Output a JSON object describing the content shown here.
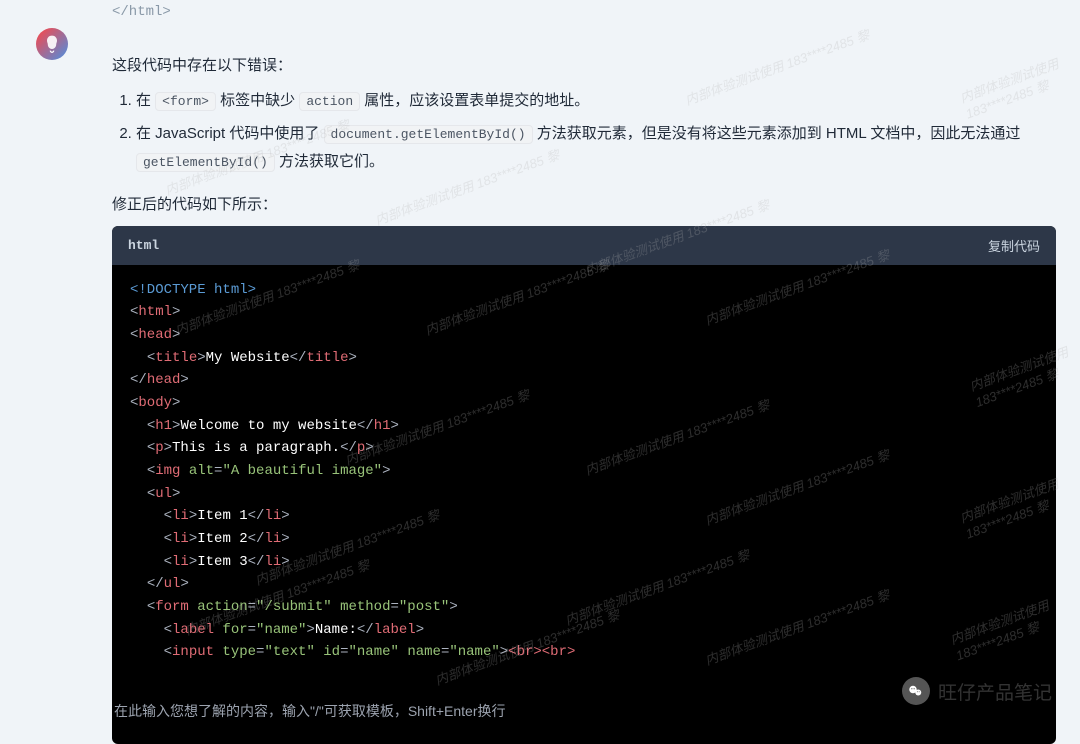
{
  "top_code_fragment": "</html>",
  "intro": "这段代码中存在以下错误：",
  "issues": [
    {
      "prefix": "在 ",
      "code1": "<form>",
      "mid1": " 标签中缺少 ",
      "code2": "action",
      "suffix": " 属性，应该设置表单提交的地址。"
    },
    {
      "prefix": "在 JavaScript 代码中使用了 ",
      "code1": "document.getElementById()",
      "mid1": " 方法获取元素，但是没有将这些元素添加到 HTML 文档中，因此无法通过 ",
      "code2": "getElementById()",
      "suffix": " 方法获取它们。"
    }
  ],
  "corrected_label": "修正后的代码如下所示：",
  "code_header": {
    "lang": "html",
    "copy": "复制代码"
  },
  "code_lines": {
    "l1": "<!DOCTYPE html>",
    "l2_open": "<",
    "l2_tag": "html",
    "l2_close": ">",
    "l3_open": "<",
    "l3_tag": "head",
    "l3_close": ">",
    "l4_pre": "  ",
    "l4_open": "<",
    "l4_tag": "title",
    "l4_close": ">",
    "l4_text": "My Website",
    "l4_open2": "</",
    "l4_tag2": "title",
    "l4_close2": ">",
    "l5_open": "</",
    "l5_tag": "head",
    "l5_close": ">",
    "l6_open": "<",
    "l6_tag": "body",
    "l6_close": ">",
    "l7_pre": "  ",
    "l7_open": "<",
    "l7_tag": "h1",
    "l7_close": ">",
    "l7_text": "Welcome to my website",
    "l7_open2": "</",
    "l7_tag2": "h1",
    "l7_close2": ">",
    "l8_pre": "  ",
    "l8_open": "<",
    "l8_tag": "p",
    "l8_close": ">",
    "l8_text": "This is a paragraph.",
    "l8_open2": "</",
    "l8_tag2": "p",
    "l8_close2": ">",
    "l9_pre": "  ",
    "l9_open": "<",
    "l9_tag": "img",
    "l9_attr": " alt",
    "l9_eq": "=",
    "l9_val": "\"A beautiful image\"",
    "l9_close": ">",
    "l10_pre": "  ",
    "l10_open": "<",
    "l10_tag": "ul",
    "l10_close": ">",
    "l11_pre": "    ",
    "l11_open": "<",
    "l11_tag": "li",
    "l11_close": ">",
    "l11_text": "Item 1",
    "l11_open2": "</",
    "l11_tag2": "li",
    "l11_close2": ">",
    "l12_pre": "    ",
    "l12_open": "<",
    "l12_tag": "li",
    "l12_close": ">",
    "l12_text": "Item 2",
    "l12_open2": "</",
    "l12_tag2": "li",
    "l12_close2": ">",
    "l13_pre": "    ",
    "l13_open": "<",
    "l13_tag": "li",
    "l13_close": ">",
    "l13_text": "Item 3",
    "l13_open2": "</",
    "l13_tag2": "li",
    "l13_close2": ">",
    "l14_pre": "  ",
    "l14_open": "</",
    "l14_tag": "ul",
    "l14_close": ">",
    "l15_pre": "  ",
    "l15_open": "<",
    "l15_tag": "form",
    "l15_attr1": " action",
    "l15_eq1": "=",
    "l15_val1": "\"/submit\"",
    "l15_attr2": " method",
    "l15_eq2": "=",
    "l15_val2": "\"post\"",
    "l15_close": ">",
    "l16_pre": "    ",
    "l16_open": "<",
    "l16_tag": "label",
    "l16_attr": " for",
    "l16_eq": "=",
    "l16_val": "\"name\"",
    "l16_close": ">",
    "l16_text": "Name:",
    "l16_open2": "</",
    "l16_tag2": "label",
    "l16_close2": ">",
    "l17_pre": "    ",
    "l17_open": "<",
    "l17_tag": "input",
    "l17_attr1": " type",
    "l17_eq1": "=",
    "l17_val1": "\"text\"",
    "l17_attr2": " id",
    "l17_eq2": "=",
    "l17_val2": "\"name\"",
    "l17_attr3": " name",
    "l17_eq3": "=",
    "l17_val3": "\"name\"",
    "l17_close": ">",
    "l17_br": "<br><br>"
  },
  "input_placeholder": "在此输入您想了解的内容，输入\"/\"可获取模板，Shift+Enter换行",
  "brand": "旺仔产品笔记",
  "watermark_text": "内部体验测试使用\n183****2485 黎"
}
